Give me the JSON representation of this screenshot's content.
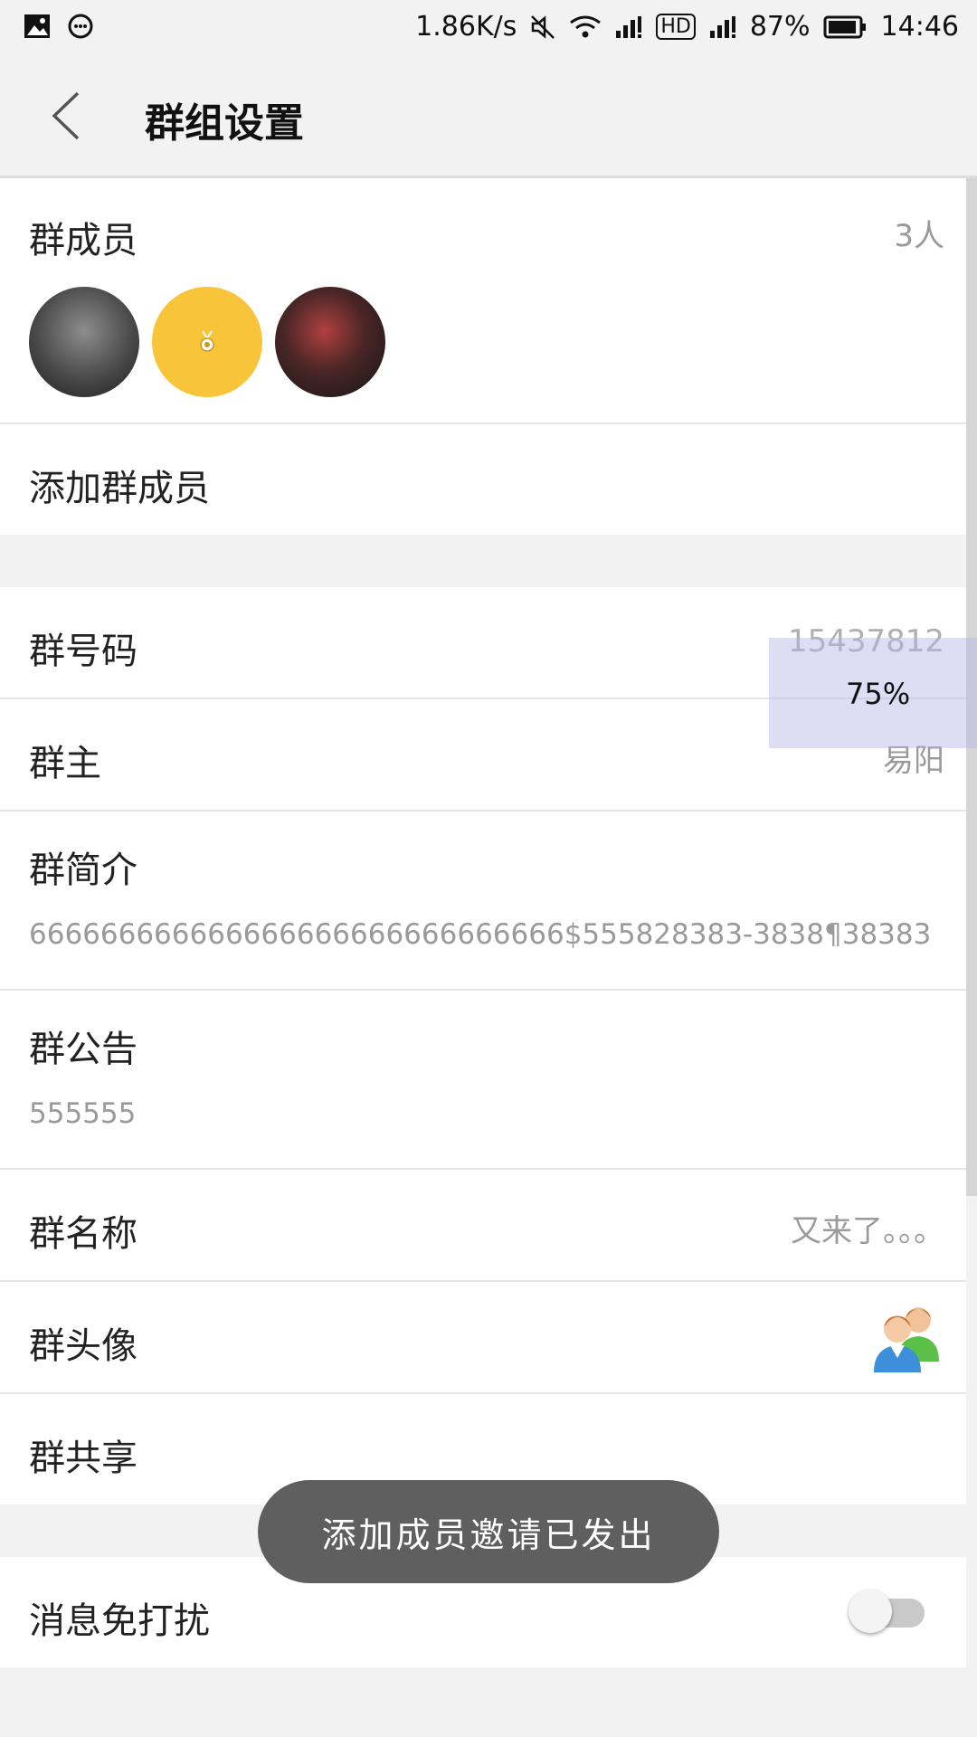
{
  "status_bar": {
    "net_speed": "1.86K/s",
    "battery": "87%",
    "time": "14:46",
    "hd": "HD"
  },
  "header": {
    "title": "群组设置"
  },
  "members": {
    "label": "群成员",
    "count": "3人"
  },
  "add_member": {
    "label": "添加群成员"
  },
  "info": {
    "group_number_label": "群号码",
    "group_number": "15437812",
    "owner_label": "群主",
    "owner": "易阳",
    "intro_label": "群简介",
    "intro_text": "666666666666666666666666666666$555828383-3838¶38383",
    "notice_label": "群公告",
    "notice_text": "555555",
    "name_label": "群名称",
    "name": "又来了。。。",
    "avatar_label": "群头像",
    "share_label": "群共享"
  },
  "dnd": {
    "label": "消息免打扰",
    "enabled": false
  },
  "overlay": {
    "text": "75%"
  },
  "toast": {
    "text": "添加成员邀请已发出"
  },
  "colors": {
    "background": "#f2f2f2",
    "card": "#ffffff",
    "secondary_text": "#9a9a9a",
    "toast_bg": "#5f5f5f",
    "avatar_yellow": "#f8c53a"
  },
  "icons": [
    "image-icon",
    "chat-bubble-icon",
    "mute-icon",
    "wifi-icon",
    "signal-icon",
    "battery-icon",
    "back-arrow-icon",
    "group-avatar-icon",
    "medal-icon"
  ]
}
